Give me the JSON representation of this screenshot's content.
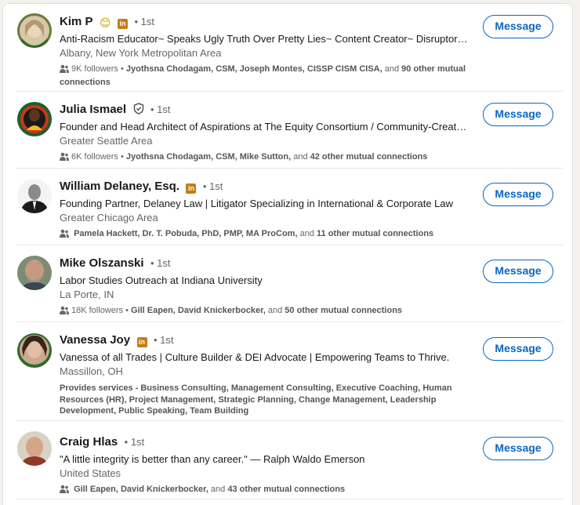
{
  "people": [
    {
      "name": "Kim P",
      "has_emoji": true,
      "emoji": "😊",
      "has_premium": true,
      "premium_glyph": "in",
      "has_verified": false,
      "degree": "• 1st",
      "headline": "Anti-Racism Educator~ Speaks Ugly Truth Over Pretty Lies~ Content Creator~ Disruptor &…",
      "location": "Albany, New York Metropolitan Area",
      "followers": "9K followers •",
      "mutuals": "Jyothsna Chodagam, CSM, Joseph Montes, CISSP CISM CISA,",
      "and_text": "and",
      "others": "90 other mutual connections",
      "button": "Message"
    },
    {
      "name": "Julia Ismael",
      "has_emoji": false,
      "has_premium": false,
      "has_verified": true,
      "degree": "• 1st",
      "headline": "Founder and Head Architect of Aspirations at The Equity Consortium / Community-Create…",
      "location": "Greater Seattle Area",
      "followers": "6K followers •",
      "mutuals": "Jyothsna Chodagam, CSM, Mike Sutton,",
      "and_text": "and",
      "others": "42 other mutual connections",
      "button": "Message"
    },
    {
      "name": "William Delaney, Esq.",
      "has_emoji": false,
      "has_premium": true,
      "premium_glyph": "in",
      "has_verified": false,
      "degree": "• 1st",
      "headline": "Founding Partner, Delaney Law | Litigator Specializing in International & Corporate Law",
      "location": "Greater Chicago Area",
      "followers": "",
      "mutuals": "Pamela Hackett, Dr. T. Pobuda, PhD, PMP, MA ProCom,",
      "and_text": "and",
      "others": "11 other mutual connections",
      "button": "Message"
    },
    {
      "name": "Mike Olszanski",
      "has_emoji": false,
      "has_premium": false,
      "has_verified": false,
      "degree": "• 1st",
      "headline": "Labor Studies Outreach at Indiana University",
      "location": "La Porte, IN",
      "followers": "18K followers •",
      "mutuals": "Gill Eapen, David Knickerbocker,",
      "and_text": "and",
      "others": "50 other mutual connections",
      "button": "Message"
    },
    {
      "name": "Vanessa Joy",
      "has_emoji": false,
      "has_premium": true,
      "premium_glyph": "in",
      "has_verified": false,
      "degree": "• 1st",
      "headline": "Vanessa of all Trades | Culture Builder & DEI Advocate | Empowering Teams to Thrive.",
      "location": "Massillon, OH",
      "services": "Provides services - Business Consulting, Management Consulting, Executive Coaching, Human Resources (HR), Project Management, Strategic Planning, Change Management, Leadership Development, Public Speaking, Team Building",
      "button": "Message"
    },
    {
      "name": "Craig Hlas",
      "has_emoji": false,
      "has_premium": false,
      "has_verified": false,
      "degree": "• 1st",
      "headline": "\"A little integrity is better than any career.\" — Ralph Waldo Emerson",
      "location": "United States",
      "followers": "",
      "mutuals": "Gill Eapen, David Knickerbocker,",
      "and_text": "and",
      "others": "43 other mutual connections",
      "button": "Message"
    }
  ]
}
